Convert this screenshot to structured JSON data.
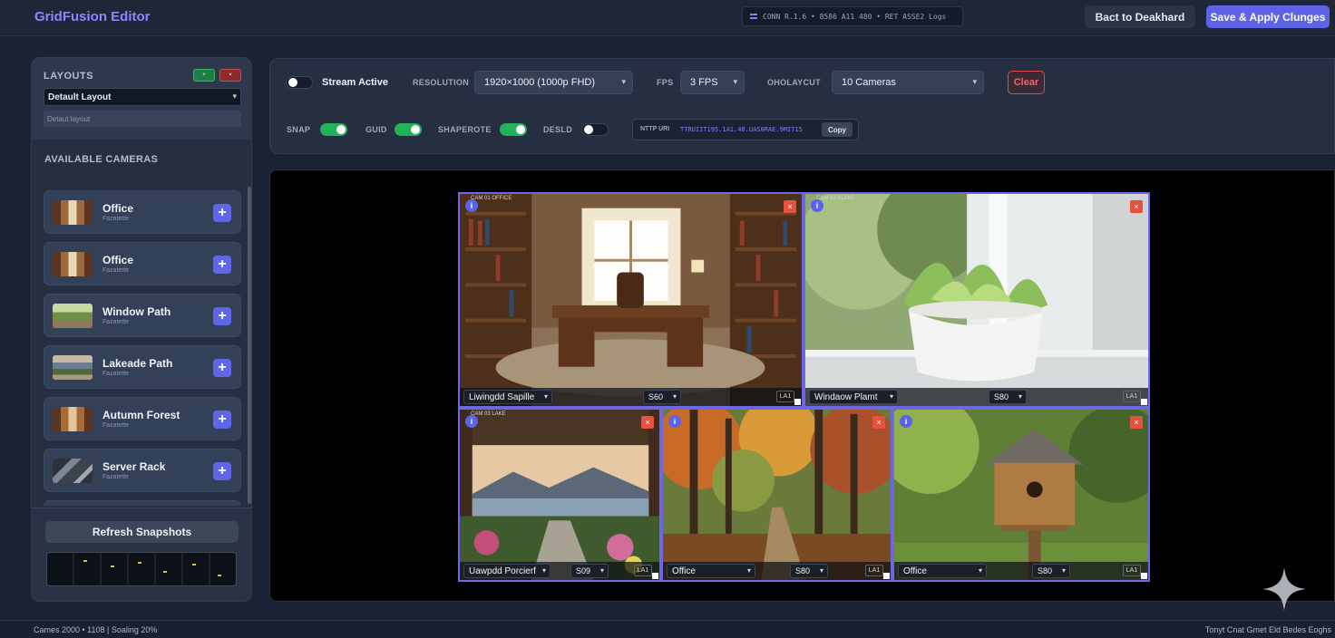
{
  "header": {
    "app_title": "GridFusion Editor",
    "status_text": "CONN  R.1.6  •  8586  A11  480  •  RET  ASSE2  Logs",
    "back_label": "Bact to Deakhard",
    "save_label": "Save & Apply Clunges"
  },
  "sidebar": {
    "layouts_title": "LAYOUTS",
    "layout_select_value": "Detault Layout",
    "layout_name_value": "Detaut layout",
    "available_title": "AVAILABLE CAMERAS",
    "cameras": [
      {
        "name": "Office",
        "subtitle": "Fazatette"
      },
      {
        "name": "Office",
        "subtitle": "Fazatette"
      },
      {
        "name": "Window Path",
        "subtitle": "Fazatette"
      },
      {
        "name": "Lakeade Path",
        "subtitle": "Fazatette"
      },
      {
        "name": "Autumn Forest",
        "subtitle": "Fazatette"
      },
      {
        "name": "Server Rack",
        "subtitle": "Fazatette"
      }
    ],
    "refresh_label": "Refresh Snapshots"
  },
  "controls": {
    "stream_label": "Stream Active",
    "stream_on": false,
    "resolution_label": "RESOLUTION",
    "resolution_value": "1920×1000 (1000p FHD)",
    "fps_label": "FPS",
    "fps_value": "3 FPS",
    "layout_label": "OHOLAYCUT",
    "layout_value": "10 Cameras",
    "clear_label": "Clear",
    "snap_label": "SNAP",
    "snap_on": true,
    "grid_label": "GUID",
    "grid_on": true,
    "snapshot_label": "SHAPEROTE",
    "snapshot_on": true,
    "debug_label": "DESLD",
    "debug_on": false,
    "url_label": "NTTP URI",
    "url_value": "TTRUIIT195.1A1.48.UAS0RAE.9MIT15",
    "copy_label": "Copy"
  },
  "tiles": [
    {
      "source": "Liwingdd Sapille",
      "fps": "S60",
      "layer": "LA1",
      "caption": "CAM 01 OFFICE"
    },
    {
      "source": "Windaow Plamt",
      "fps": "S80",
      "layer": "LA1",
      "caption": "CAM 02 PLANT"
    },
    {
      "source": "Uawpdd Porcierf",
      "fps": "S09",
      "layer": "LA1",
      "caption": "CAM 03 LAKE"
    },
    {
      "source": "Office",
      "fps": "S80",
      "layer": "LA1",
      "caption": ""
    },
    {
      "source": "Office",
      "fps": "S80",
      "layer": "LA1",
      "caption": ""
    }
  ],
  "footer": {
    "left_text": "Cames  2000  •  1108  |  Soaling 20%",
    "right_text": "Tonyt Cnat  Gmet Eld Bedes Eoghs"
  }
}
